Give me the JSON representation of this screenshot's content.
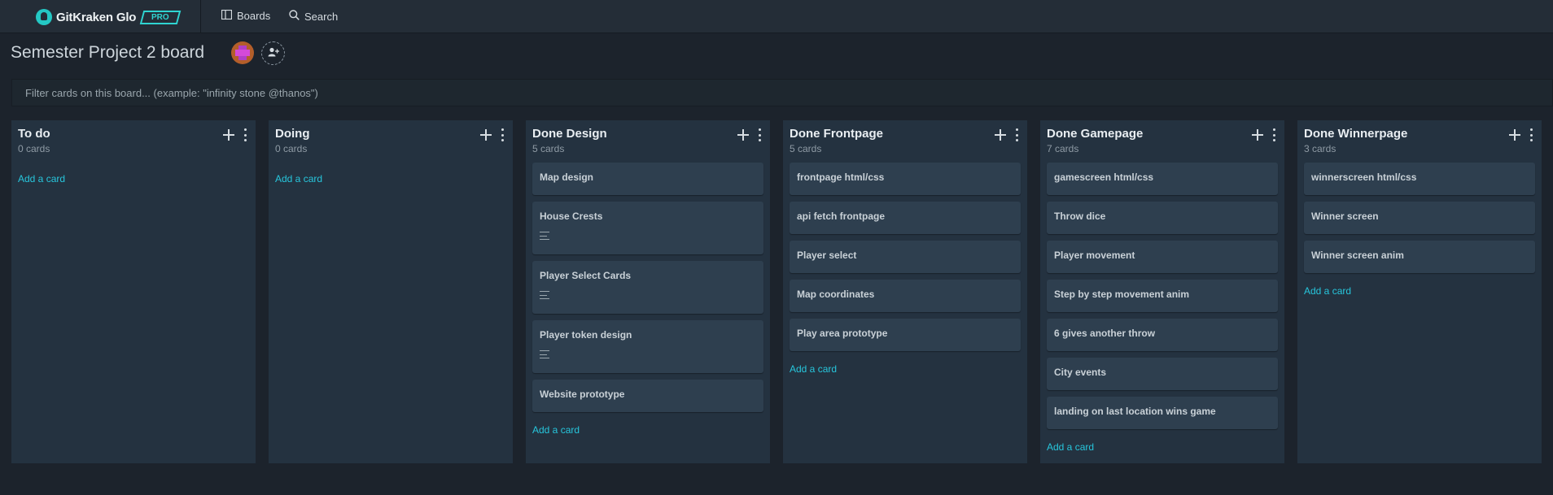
{
  "app": {
    "name": "GitKraken Glo",
    "badge": "PRO",
    "accent": "#2fd4d1",
    "link_color": "#27c6dc"
  },
  "nav": {
    "boards_label": "Boards",
    "boards_icon": "boards-icon",
    "search_label": "Search",
    "search_icon": "search-icon"
  },
  "board": {
    "title": "Semester Project 2 board",
    "filter_placeholder": "Filter cards on this board... (example: \"infinity stone @thanos\")"
  },
  "columns": [
    {
      "title": "To do",
      "count": "0 cards",
      "add_label": "Add a card",
      "cards": []
    },
    {
      "title": "Doing",
      "count": "0 cards",
      "add_label": "Add a card",
      "cards": []
    },
    {
      "title": "Done Design",
      "count": "5 cards",
      "add_label": "Add a card",
      "cards": [
        {
          "title": "Map design",
          "has_description": false
        },
        {
          "title": "House Crests",
          "has_description": true
        },
        {
          "title": "Player Select Cards",
          "has_description": true
        },
        {
          "title": "Player token design",
          "has_description": true
        },
        {
          "title": "Website prototype",
          "has_description": false
        }
      ]
    },
    {
      "title": "Done Frontpage",
      "count": "5 cards",
      "add_label": "Add a card",
      "cards": [
        {
          "title": "frontpage html/css",
          "has_description": false
        },
        {
          "title": "api fetch frontpage",
          "has_description": false
        },
        {
          "title": "Player select",
          "has_description": false
        },
        {
          "title": "Map coordinates",
          "has_description": false
        },
        {
          "title": "Play area prototype",
          "has_description": false
        }
      ]
    },
    {
      "title": "Done Gamepage",
      "count": "7 cards",
      "add_label": "Add a card",
      "cards": [
        {
          "title": "gamescreen html/css",
          "has_description": false
        },
        {
          "title": "Throw dice",
          "has_description": false
        },
        {
          "title": "Player movement",
          "has_description": false
        },
        {
          "title": "Step by step movement anim",
          "has_description": false
        },
        {
          "title": "6 gives another throw",
          "has_description": false
        },
        {
          "title": "City events",
          "has_description": false
        },
        {
          "title": "landing on last location wins game",
          "has_description": false
        }
      ]
    },
    {
      "title": "Done Winnerpage",
      "count": "3 cards",
      "add_label": "Add a card",
      "cards": [
        {
          "title": "winnerscreen html/css",
          "has_description": false
        },
        {
          "title": "Winner screen",
          "has_description": false
        },
        {
          "title": "Winner screen anim",
          "has_description": false
        }
      ]
    }
  ]
}
